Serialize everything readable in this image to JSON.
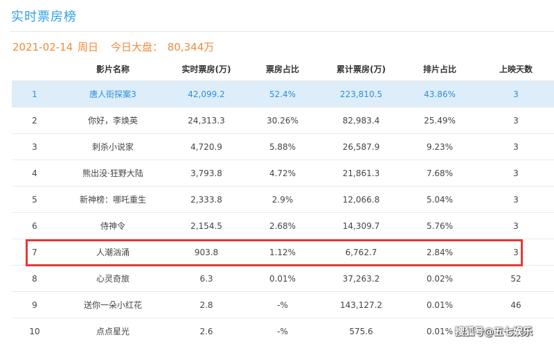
{
  "page": {
    "title": "实时票房榜"
  },
  "summary": {
    "date": "2021-02-14",
    "weekday": "周日",
    "total_label": "今日大盘：",
    "total_value": "80,344万"
  },
  "table": {
    "headers": [
      "",
      "影片名称",
      "实时票房(万)",
      "票房占比",
      "累计票房(万)",
      "排片占比",
      "上映天数"
    ],
    "rows": [
      {
        "rank": "1",
        "name": "唐人街探案3",
        "realtime": "42,099.2",
        "share": "52.4%",
        "cumulative": "223,810.5",
        "schedule": "43.86%",
        "days": "3"
      },
      {
        "rank": "2",
        "name": "你好，李焕英",
        "realtime": "24,313.3",
        "share": "30.26%",
        "cumulative": "82,983.4",
        "schedule": "25.49%",
        "days": "3"
      },
      {
        "rank": "3",
        "name": "刺杀小说家",
        "realtime": "4,720.9",
        "share": "5.88%",
        "cumulative": "26,587.9",
        "schedule": "9.23%",
        "days": "3"
      },
      {
        "rank": "4",
        "name": "熊出没·狂野大陆",
        "realtime": "3,793.8",
        "share": "4.72%",
        "cumulative": "21,861.3",
        "schedule": "7.68%",
        "days": "3"
      },
      {
        "rank": "5",
        "name": "新神榜：哪吒重生",
        "realtime": "2,333.8",
        "share": "2.9%",
        "cumulative": "12,066.8",
        "schedule": "5.04%",
        "days": "3"
      },
      {
        "rank": "6",
        "name": "侍神令",
        "realtime": "2,154.5",
        "share": "2.68%",
        "cumulative": "14,309.7",
        "schedule": "5.76%",
        "days": "3"
      },
      {
        "rank": "7",
        "name": "人潮汹涌",
        "realtime": "903.8",
        "share": "1.12%",
        "cumulative": "6,762.7",
        "schedule": "2.84%",
        "days": "3"
      },
      {
        "rank": "8",
        "name": "心灵奇旅",
        "realtime": "6.3",
        "share": "0.01%",
        "cumulative": "37,263.2",
        "schedule": "0.02%",
        "days": "52"
      },
      {
        "rank": "9",
        "name": "送你一朵小红花",
        "realtime": "2.8",
        "share": "-%",
        "cumulative": "143,127.2",
        "schedule": "0.01%",
        "days": "46"
      },
      {
        "rank": "10",
        "name": "点点星光",
        "realtime": "2.6",
        "share": "-%",
        "cumulative": "575.6",
        "schedule": "0.01%",
        "days": ""
      }
    ]
  },
  "watermark": {
    "text": "搜狐号@五七娱乐"
  },
  "colors": {
    "title": "#2fa0e4",
    "date_line": "#f08a3c",
    "top_row_bg": "#ddeefa",
    "top_row_text": "#2f8fd8",
    "highlight_border": "#e43a34"
  }
}
